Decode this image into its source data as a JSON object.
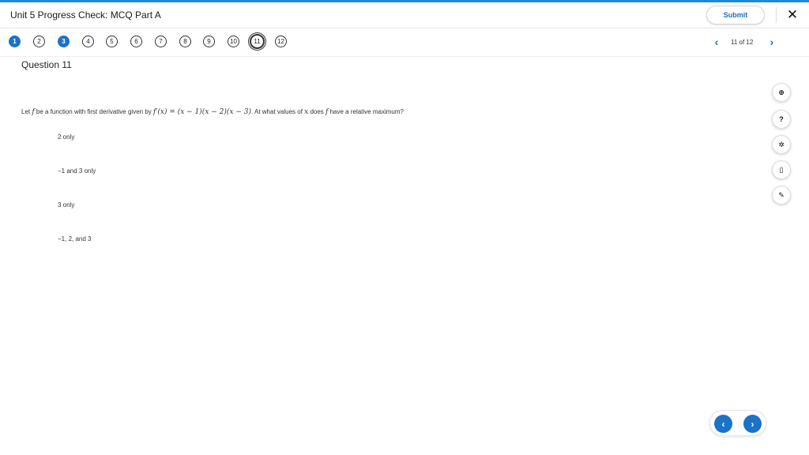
{
  "header": {
    "title": "Unit 5 Progress Check: MCQ Part A",
    "submit_label": "Submit",
    "close_glyph": "✕"
  },
  "question_nav": {
    "questions": [
      {
        "label": "1",
        "state": "answered"
      },
      {
        "label": "2",
        "state": "unanswered"
      },
      {
        "label": "3",
        "state": "answered"
      },
      {
        "label": "4",
        "state": "unanswered"
      },
      {
        "label": "5",
        "state": "unanswered"
      },
      {
        "label": "6",
        "state": "unanswered"
      },
      {
        "label": "7",
        "state": "unanswered"
      },
      {
        "label": "8",
        "state": "unanswered"
      },
      {
        "label": "9",
        "state": "unanswered"
      },
      {
        "label": "10",
        "state": "unanswered"
      },
      {
        "label": "11",
        "state": "current"
      },
      {
        "label": "12",
        "state": "unanswered"
      }
    ],
    "pager_text": "11 of 12",
    "prev_glyph": "‹",
    "next_glyph": "›"
  },
  "question": {
    "heading": "Question 11",
    "stem_parts": [
      {
        "type": "text",
        "value": "Let "
      },
      {
        "type": "math",
        "value": "f"
      },
      {
        "type": "text",
        "value": " be a function with first derivative given by "
      },
      {
        "type": "math",
        "value": "f′(x) = (x − 1)(x − 2)(x − 3)"
      },
      {
        "type": "text",
        "value": ". At what values of "
      },
      {
        "type": "math",
        "value": "x"
      },
      {
        "type": "text",
        "value": " does "
      },
      {
        "type": "math",
        "value": "f"
      },
      {
        "type": "text",
        "value": " have a relative maximum?"
      }
    ],
    "choices": [
      {
        "label": "2 only"
      },
      {
        "label": "−1 and 3 only"
      },
      {
        "label": "3 only"
      },
      {
        "label": "−1, 2, and 3"
      }
    ]
  },
  "tools": [
    {
      "name": "zoom-icon",
      "glyph": "⊕"
    },
    {
      "name": "help-icon",
      "glyph": "?"
    },
    {
      "name": "gear-icon",
      "glyph": "✲"
    },
    {
      "name": "bookmark-icon",
      "glyph": "▯"
    },
    {
      "name": "pencil-icon",
      "glyph": "✎"
    }
  ],
  "bottom_nav": {
    "prev_glyph": "‹",
    "next_glyph": "›"
  },
  "colors": {
    "accent": "#1a73c6",
    "top_bar": "#1a8bd6"
  }
}
